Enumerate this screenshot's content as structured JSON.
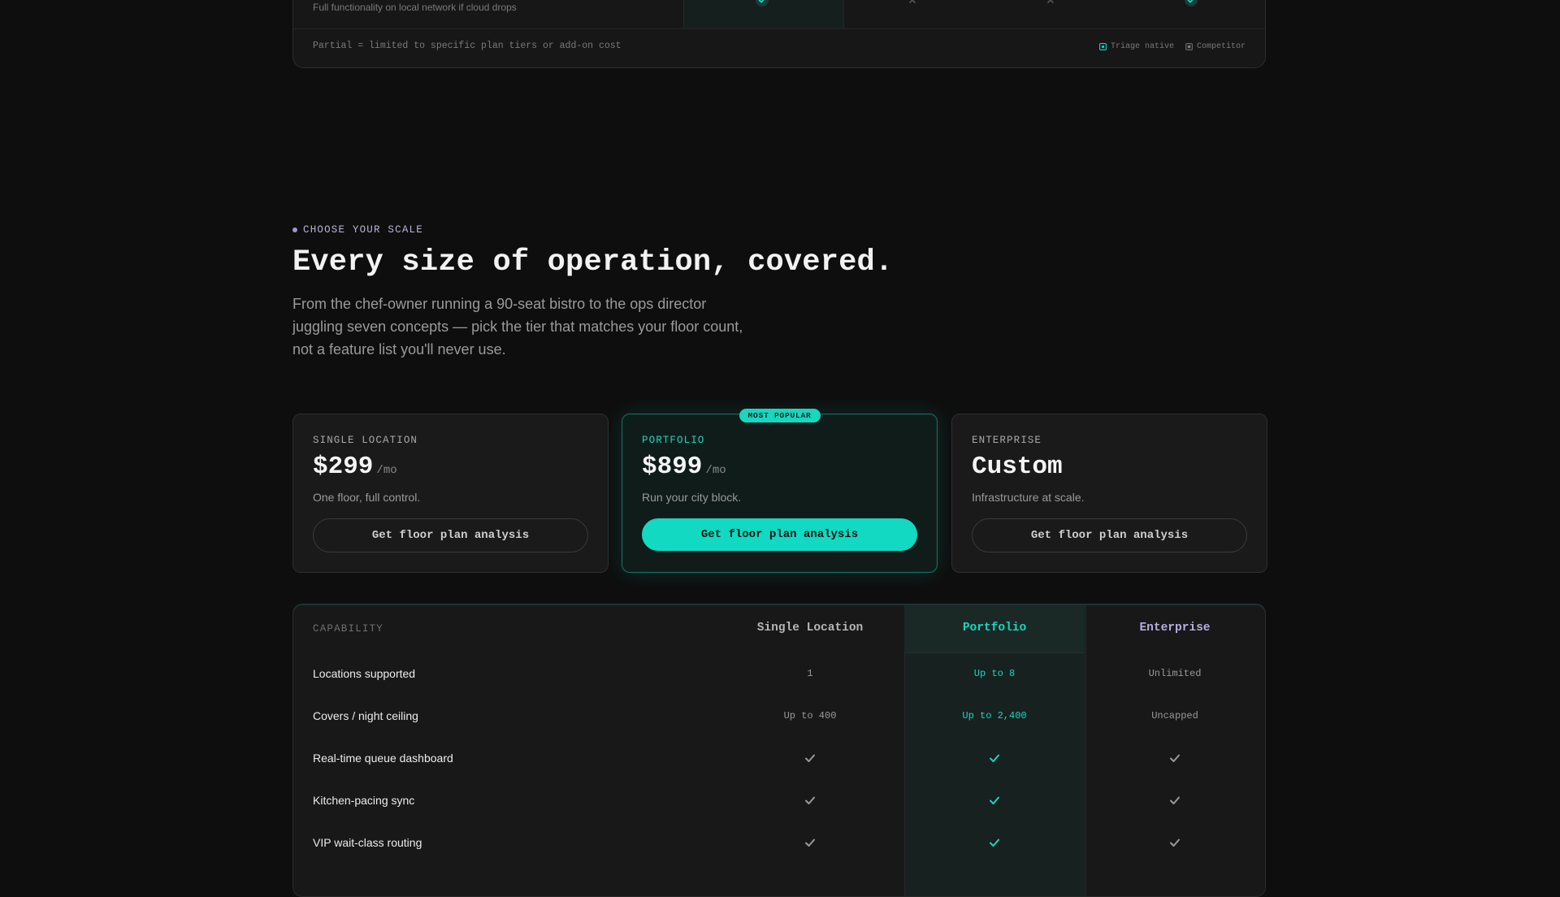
{
  "comparison": {
    "last_row_description": "Full functionality on local network if cloud drops",
    "footnote": "Partial = limited to specific plan tiers or add-on cost",
    "legend": {
      "native": "Triage native",
      "competitor": "Competitor"
    }
  },
  "pricing": {
    "eyebrow": "CHOOSE YOUR SCALE",
    "title": "Every size of operation, covered.",
    "subtitle_lines": [
      "From the chef-owner running a 90-seat bistro to the ops director",
      "juggling seven concepts — pick the tier that matches your floor count,",
      "not a feature list you'll never use."
    ],
    "plans": [
      {
        "tier": "SINGLE LOCATION",
        "price": "$299",
        "period": "/mo",
        "tagline": "One floor, full control.",
        "cta": "Get floor plan analysis"
      },
      {
        "tier": "PORTFOLIO",
        "badge": "MOST POPULAR",
        "price": "$899",
        "period": "/mo",
        "tagline": "Run your city block.",
        "cta": "Get floor plan analysis"
      },
      {
        "tier": "ENTERPRISE",
        "price": "Custom",
        "tagline": "Infrastructure at scale.",
        "cta": "Get floor plan analysis"
      }
    ]
  },
  "capabilities": {
    "header": {
      "label": "CAPABILITY",
      "columns": [
        "Single Location",
        "Portfolio",
        "Enterprise"
      ]
    },
    "rows": [
      {
        "label": "Locations supported",
        "values": [
          "1",
          "Up to 8",
          "Unlimited"
        ]
      },
      {
        "label": "Covers / night ceiling",
        "values": [
          "Up to 400",
          "Up to 2,400",
          "Uncapped"
        ]
      },
      {
        "label": "Real-time queue dashboard",
        "values": [
          "check",
          "check",
          "check"
        ]
      },
      {
        "label": "Kitchen-pacing sync",
        "values": [
          "check",
          "check",
          "check"
        ]
      },
      {
        "label": "VIP wait-class routing",
        "values": [
          "check",
          "check",
          "check"
        ]
      }
    ]
  },
  "colors": {
    "accent": "#19d6bf",
    "enterprise": "#b4aee0",
    "background": "#0e0e0e"
  }
}
